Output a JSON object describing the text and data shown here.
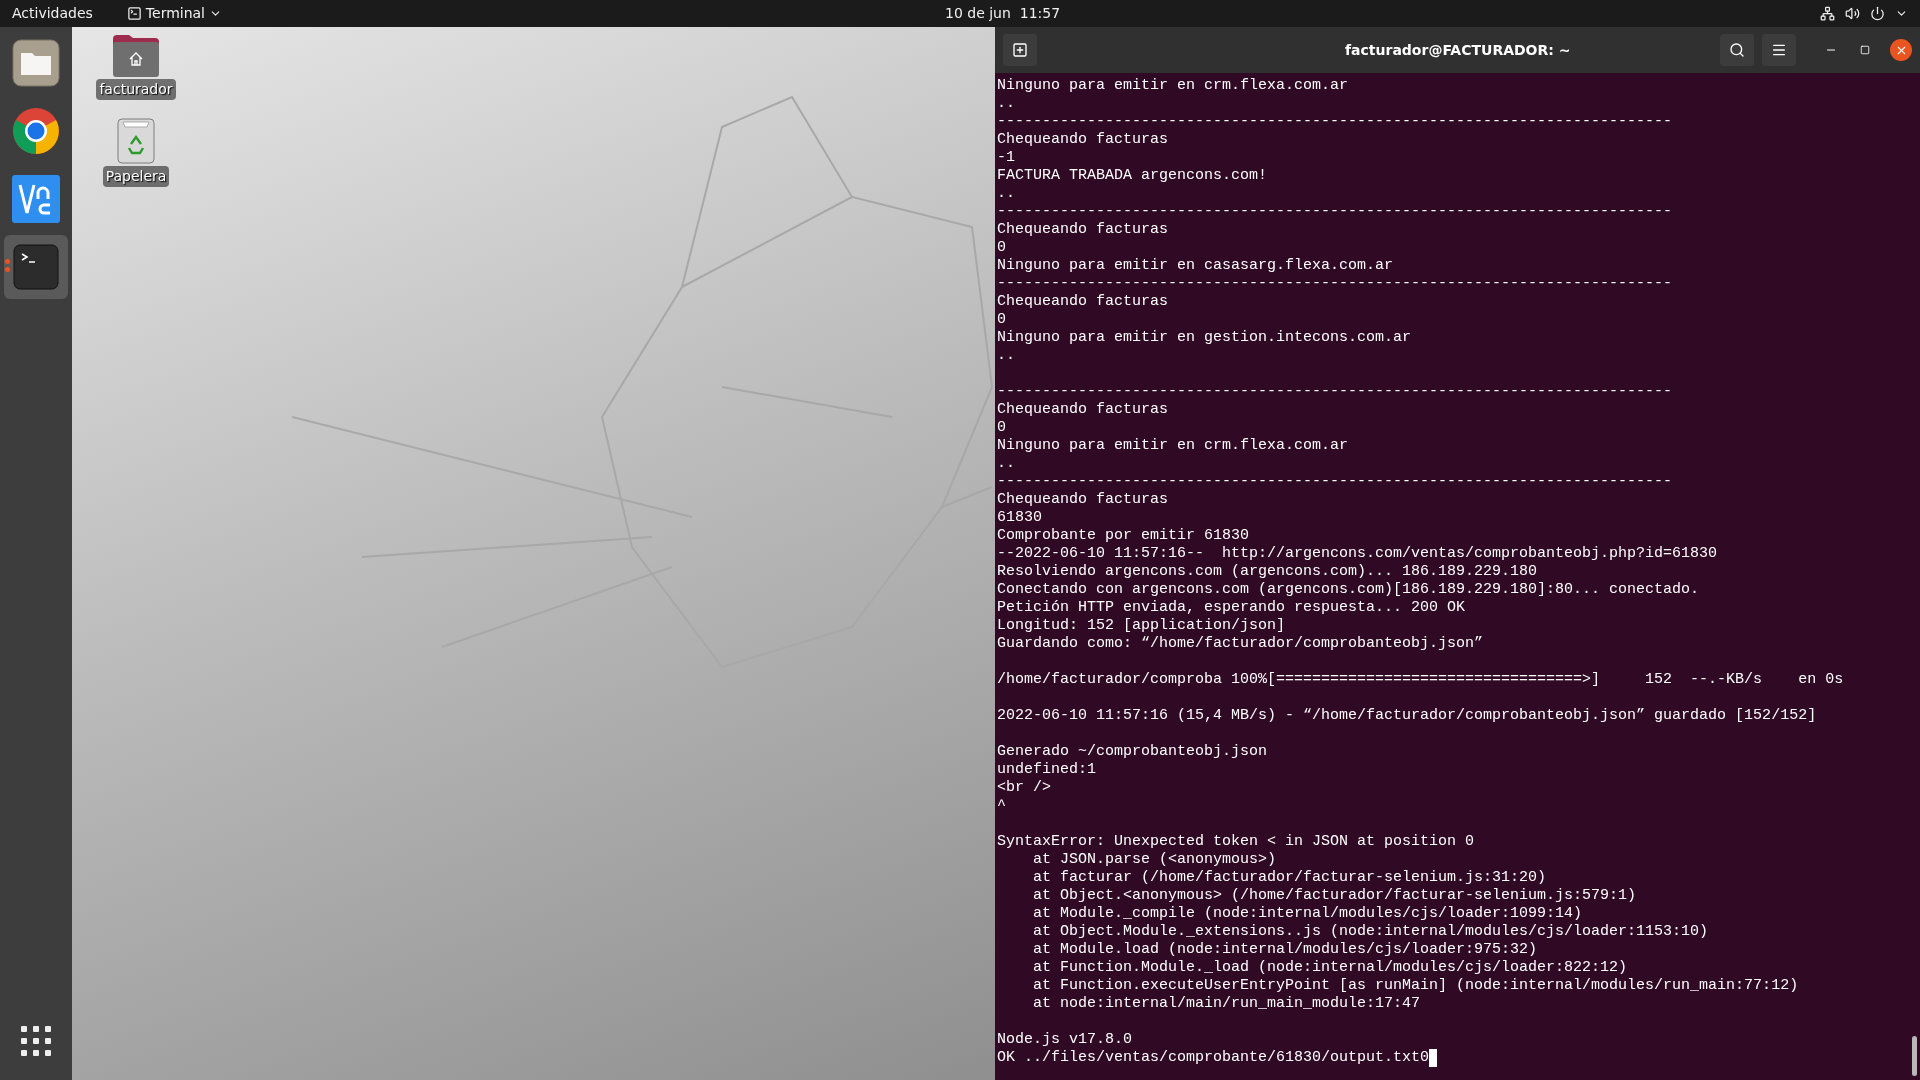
{
  "top_bar": {
    "activities": "Actividades",
    "app_menu": "Terminal",
    "clock": "10 de jun  11:57"
  },
  "dock": {
    "apps": [
      {
        "kind": "files",
        "running": false
      },
      {
        "kind": "chrome",
        "running": false
      },
      {
        "kind": "vnc",
        "running": false
      },
      {
        "kind": "terminal",
        "running": true
      }
    ]
  },
  "desktop": {
    "icons": [
      {
        "kind": "home",
        "label": "facturador"
      },
      {
        "kind": "trash",
        "label": "Papelera"
      }
    ]
  },
  "terminal": {
    "title": "facturador@FACTURADOR: ~",
    "cursor": true,
    "blocks": [
      [
        "Ninguno para emitir en crm.flexa.com.ar",
        "..",
        "---------------------------------------------------------------------------",
        "Chequeando facturas",
        "-1",
        "FACTURA TRABADA argencons.com!",
        "..",
        "---------------------------------------------------------------------------",
        "Chequeando facturas",
        "0",
        "Ninguno para emitir en casasarg.flexa.com.ar",
        "---------------------------------------------------------------------------",
        "Chequeando facturas",
        "0",
        "Ninguno para emitir en gestion.intecons.com.ar",
        ".."
      ],
      [
        "---------------------------------------------------------------------------",
        "Chequeando facturas",
        "0",
        "Ninguno para emitir en crm.flexa.com.ar",
        "..",
        "---------------------------------------------------------------------------",
        "Chequeando facturas",
        "61830",
        "Comprobante por emitir 61830",
        "--2022-06-10 11:57:16--  http://argencons.com/ventas/comprobanteobj.php?id=61830",
        "Resolviendo argencons.com (argencons.com)... 186.189.229.180",
        "Conectando con argencons.com (argencons.com)[186.189.229.180]:80... conectado.",
        "Petición HTTP enviada, esperando respuesta... 200 OK",
        "Longitud: 152 [application/json]",
        "Guardando como: “/home/facturador/comprobanteobj.json”"
      ],
      [
        "/home/facturador/comproba 100%[==================================>]     152  --.-KB/s    en 0s"
      ],
      [
        "2022-06-10 11:57:16 (15,4 MB/s) - “/home/facturador/comprobanteobj.json” guardado [152/152]"
      ],
      [
        "Generado ~/comprobanteobj.json",
        "undefined:1",
        "<br />",
        "^"
      ],
      [
        "SyntaxError: Unexpected token < in JSON at position 0",
        "    at JSON.parse (<anonymous>)",
        "    at facturar (/home/facturador/facturar-selenium.js:31:20)",
        "    at Object.<anonymous> (/home/facturador/facturar-selenium.js:579:1)",
        "    at Module._compile (node:internal/modules/cjs/loader:1099:14)",
        "    at Object.Module._extensions..js (node:internal/modules/cjs/loader:1153:10)",
        "    at Module.load (node:internal/modules/cjs/loader:975:32)",
        "    at Function.Module._load (node:internal/modules/cjs/loader:822:12)",
        "    at Function.executeUserEntryPoint [as runMain] (node:internal/modules/run_main:77:12)",
        "    at node:internal/main/run_main_module:17:47"
      ],
      [
        "Node.js v17.8.0",
        "OK ../files/ventas/comprobante/61830/output.txt0"
      ]
    ]
  }
}
